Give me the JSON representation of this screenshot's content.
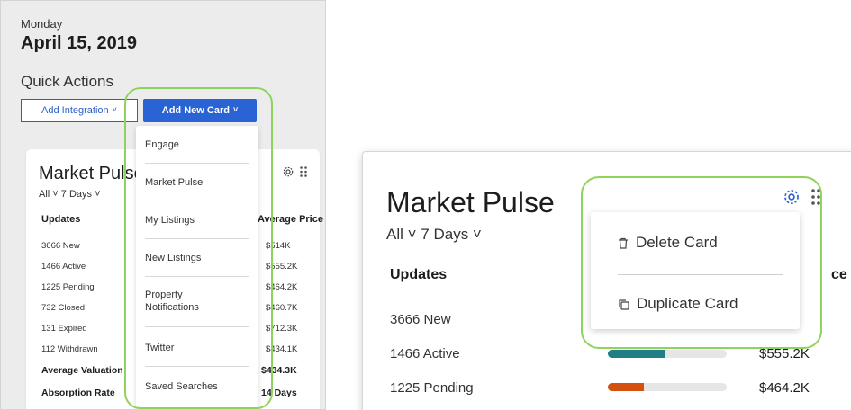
{
  "left": {
    "day": "Monday",
    "date": "April 15, 2019",
    "quick_actions": "Quick Actions",
    "add_integration": "Add Integration",
    "add_new_card": "Add New Card",
    "card": {
      "title": "Market Pulse",
      "filter_all": "All",
      "filter_days": "7 Days",
      "col_updates": "Updates",
      "col_price": "Average Price",
      "rows": [
        {
          "label": "3666 New",
          "value": "$514K"
        },
        {
          "label": "1466 Active",
          "value": "$555.2K"
        },
        {
          "label": "1225 Pending",
          "value": "$464.2K"
        },
        {
          "label": "732 Closed",
          "value": "$460.7K"
        },
        {
          "label": "131 Expired",
          "value": "$712.3K"
        },
        {
          "label": "112 Withdrawn",
          "value": "$434.1K"
        }
      ],
      "avg_valuation": "Average Valuation",
      "avg_valuation_value": "$434.3K",
      "absorption_rate": "Absorption Rate",
      "absorption_value": "14 Days"
    },
    "menu": [
      "Engage",
      "Market Pulse",
      "My Listings",
      "New Listings",
      "Property Notifications",
      "Twitter",
      "Saved Searches"
    ]
  },
  "right": {
    "title": "Market Pulse",
    "filter_all": "All",
    "filter_days": "7 Days",
    "col_updates": "Updates",
    "col_price_fragment": "ce",
    "rows": [
      {
        "label": "3666 New",
        "value": "",
        "bar_color": "#2aa37a",
        "bar_fraction": 0.0
      },
      {
        "label": "1466 Active",
        "value": "$555.2K",
        "bar_color": "#1f7f86",
        "bar_fraction": 0.48
      },
      {
        "label": "1225 Pending",
        "value": "$464.2K",
        "bar_color": "#d3500f",
        "bar_fraction": 0.3
      }
    ],
    "menu": {
      "delete": "Delete Card",
      "duplicate": "Duplicate Card"
    }
  },
  "colors": {
    "accent": "#2a63d4",
    "highlight": "#8fd45a"
  }
}
